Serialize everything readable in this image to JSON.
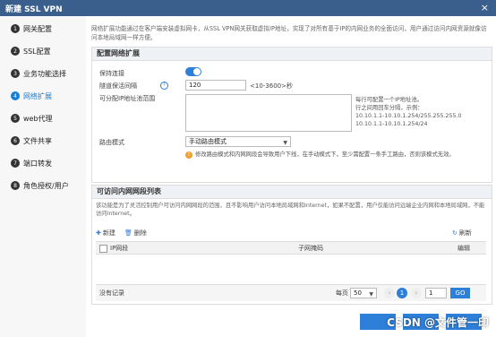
{
  "window": {
    "title": "新建 SSL VPN",
    "close": "×"
  },
  "sidebar": {
    "items": [
      {
        "num": "1",
        "label": "网关配置"
      },
      {
        "num": "2",
        "label": "SSL配置"
      },
      {
        "num": "3",
        "label": "业务功能选择"
      },
      {
        "num": "4",
        "label": "网络扩展"
      },
      {
        "num": "5",
        "label": "web代理"
      },
      {
        "num": "6",
        "label": "文件共享"
      },
      {
        "num": "7",
        "label": "端口转发"
      },
      {
        "num": "8",
        "label": "角色授权/用户"
      }
    ]
  },
  "intro": "网络扩展功能通过在客户端安装虚拟网卡，从SSL VPN网关获取虚拟IP地址，实现了对所有基于IP的内网业务的全面访问，用户通过访问内网资源就像访问本地局域网一样方便。",
  "config": {
    "title": "配置网络扩展",
    "keepalive_label": "保持连接",
    "interval_label": "隧道保活间隔",
    "interval_value": "120",
    "interval_unit": "<10-3600>秒",
    "pool_label": "可分配IP地址池范围",
    "pool_hint": [
      "每行可配置一个IP地址池。",
      "行之间用回车分隔，示例：",
      "10.10.1.1-10.10.1.254/255.255.255.0",
      "10.10.1.1-10.10.1.254/24"
    ],
    "route_label": "路由模式",
    "route_value": "手动路由模式",
    "route_note": "修改路由模式和内网网段会导致用户下线，在手动模式下，至少需配置一条手工路由，否则该模式无效。"
  },
  "subnets": {
    "title": "可访问内网网段列表",
    "desc": "该功能是为了灵活控制用户可访问内网网段的范围，且不影响用户访问本地局域网和Internet，如果不配置，用户仅能访问远端企业内网和本地局域网，不能访问Internet。",
    "new_label": "新建",
    "delete_label": "删除",
    "refresh_label": "刷新",
    "columns": [
      "IP网段",
      "子网掩码",
      "编辑"
    ],
    "empty": "没有记录",
    "per_page_label": "每页",
    "per_page_value": "50",
    "current_page": "1",
    "page_input": "1",
    "go_label": "GO"
  },
  "watermark": "CSDN @文件管一印",
  "accent": "#2d7fd8"
}
